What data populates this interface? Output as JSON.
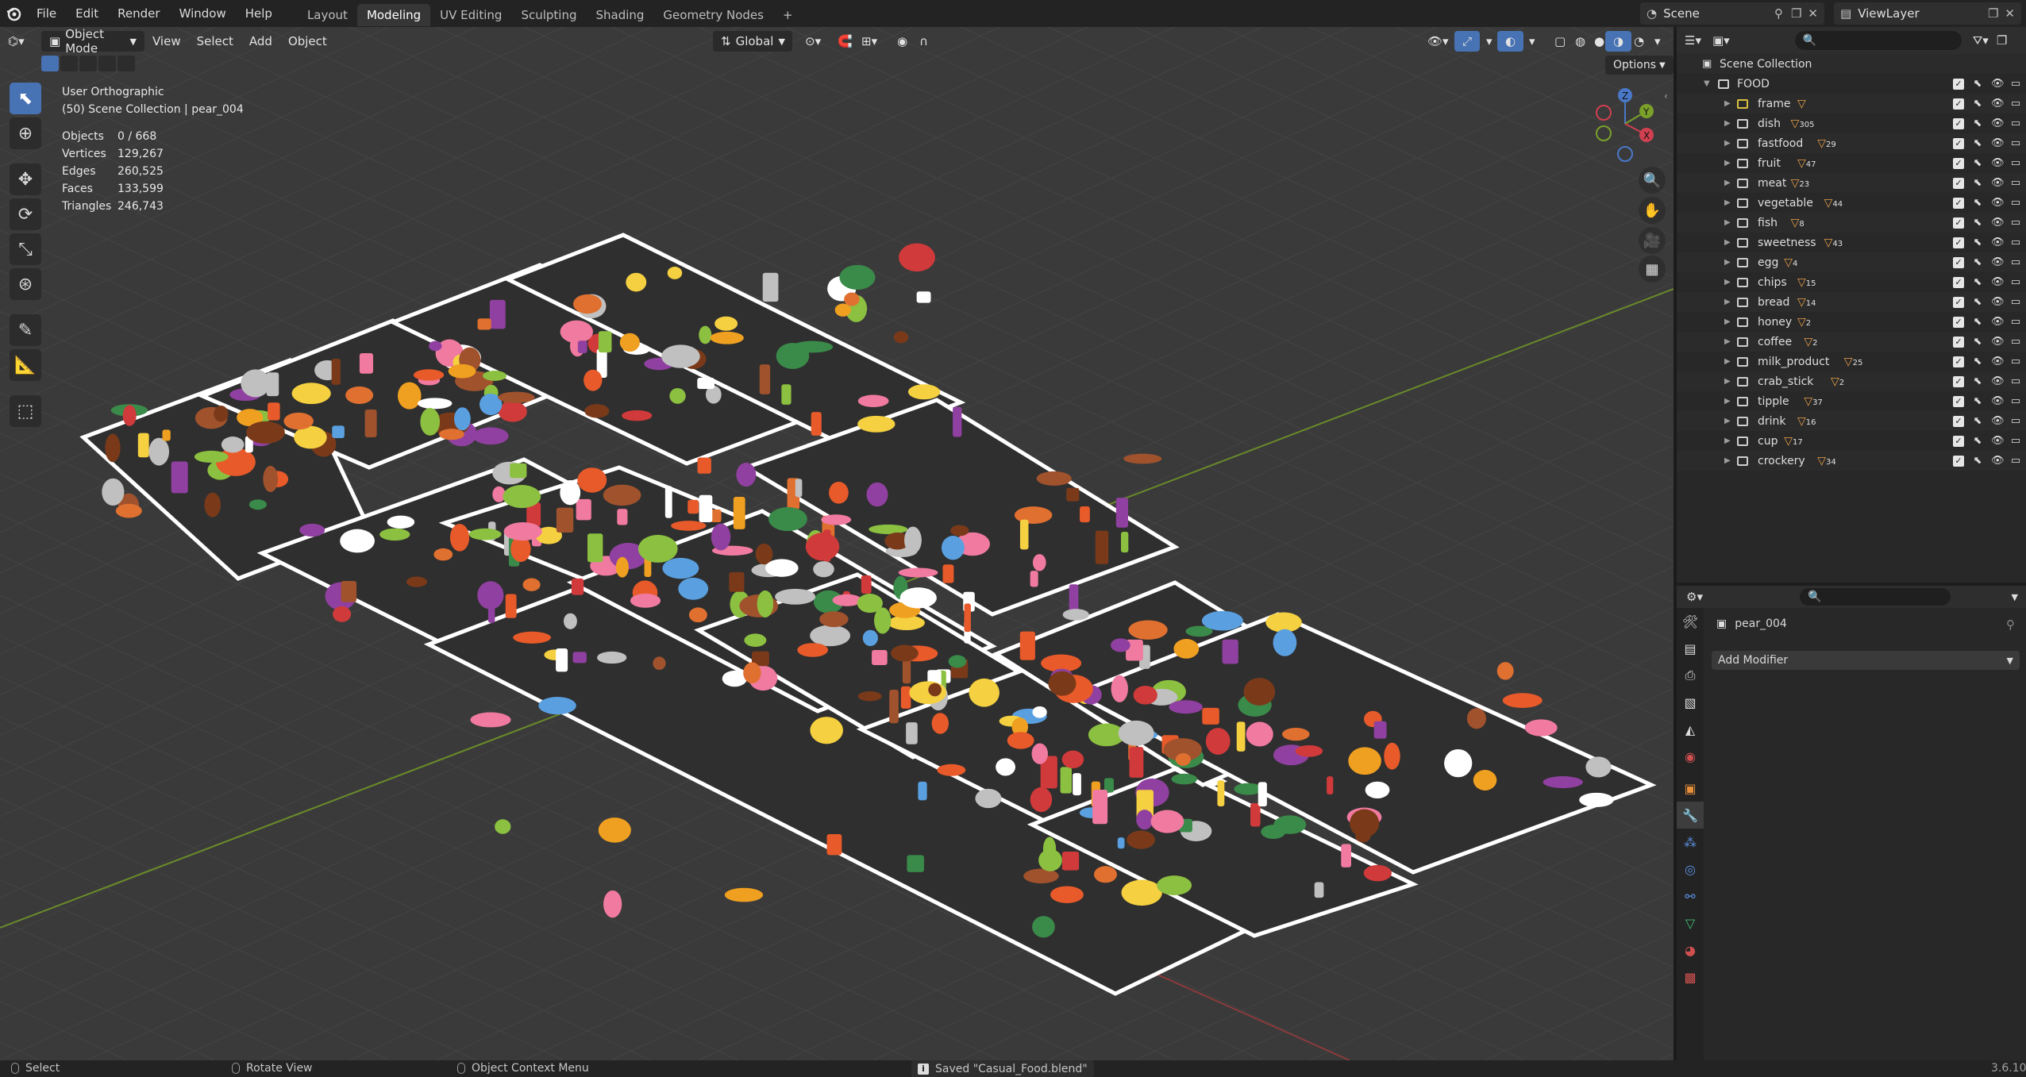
{
  "menubar": {
    "menus": [
      "File",
      "Edit",
      "Render",
      "Window",
      "Help"
    ],
    "workspaces": [
      "Layout",
      "Modeling",
      "UV Editing",
      "Sculpting",
      "Shading",
      "Geometry Nodes"
    ],
    "active_workspace": "Modeling",
    "add_workspace": "+",
    "scene": "Scene",
    "view_layer": "ViewLayer"
  },
  "viewport_header": {
    "mode": "Object Mode",
    "menus": [
      "View",
      "Select",
      "Add",
      "Object"
    ],
    "transform_orientation": "Global",
    "options": "Options"
  },
  "overlay_text": {
    "view_name": "User Orthographic",
    "collection_info": "(50) Scene Collection | pear_004"
  },
  "stats": [
    {
      "label": "Objects",
      "value": "0 / 668"
    },
    {
      "label": "Vertices",
      "value": "129,267"
    },
    {
      "label": "Edges",
      "value": "260,525"
    },
    {
      "label": "Faces",
      "value": "133,599"
    },
    {
      "label": "Triangles",
      "value": "246,743"
    }
  ],
  "gizmo": {
    "x": "X",
    "y": "Y",
    "z": "Z"
  },
  "outliner": {
    "root": "Scene Collection",
    "parent": "FOOD",
    "collections": [
      {
        "name": "frame",
        "count": ""
      },
      {
        "name": "dish",
        "count": "305"
      },
      {
        "name": "fastfood",
        "count": "29"
      },
      {
        "name": "fruit",
        "count": "47"
      },
      {
        "name": "meat",
        "count": "23"
      },
      {
        "name": "vegetable",
        "count": "44"
      },
      {
        "name": "fish",
        "count": "8"
      },
      {
        "name": "sweetness",
        "count": "43"
      },
      {
        "name": "egg",
        "count": "4"
      },
      {
        "name": "chips",
        "count": "15"
      },
      {
        "name": "bread",
        "count": "14"
      },
      {
        "name": "honey",
        "count": "2"
      },
      {
        "name": "coffee",
        "count": "2"
      },
      {
        "name": "milk_product",
        "count": "25"
      },
      {
        "name": "crab_stick",
        "count": "2"
      },
      {
        "name": "tipple",
        "count": "37"
      },
      {
        "name": "drink",
        "count": "16"
      },
      {
        "name": "cup",
        "count": "17"
      },
      {
        "name": "crockery",
        "count": "34"
      }
    ]
  },
  "properties": {
    "object_name": "pear_004",
    "add_modifier": "Add Modifier"
  },
  "statusbar": {
    "select": "Select",
    "rotate": "Rotate View",
    "context_menu": "Object Context Menu",
    "message": "Saved \"Casual_Food.blend\"",
    "version": "3.6.10"
  },
  "colors": {
    "accent": "#4772b3",
    "viewport_bg": "#3a3a3a",
    "grid_x_axis": "#8a3a3a",
    "grid_y_axis": "#6a8a2a",
    "collection_badge": "#e8a04a"
  }
}
